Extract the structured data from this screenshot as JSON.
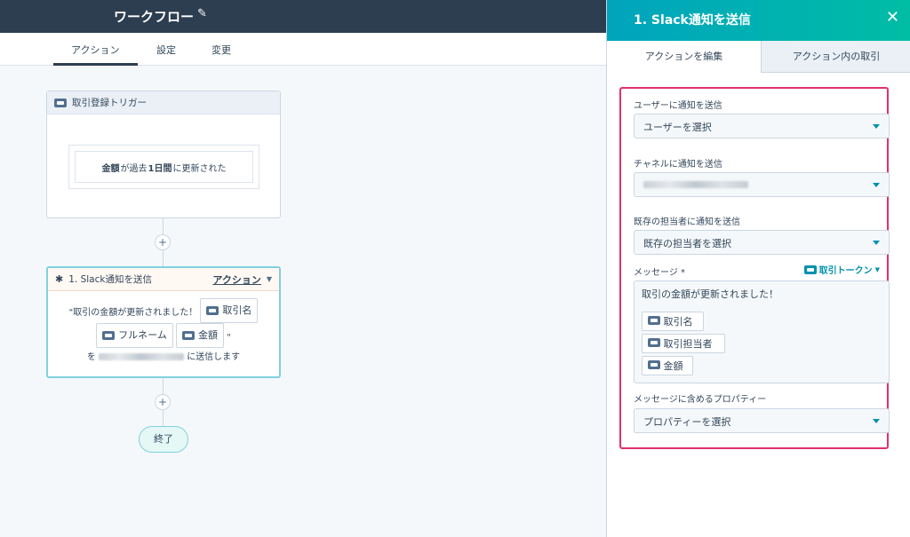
{
  "topbar": {
    "title": "ワークフロー",
    "edit_icon": "pencil-icon"
  },
  "tabs": [
    {
      "label": "アクション"
    },
    {
      "label": "設定"
    },
    {
      "label": "変更"
    }
  ],
  "trigger": {
    "title": "取引登録トリガー",
    "condition_bold1": "金額",
    "condition_mid": "が過去",
    "condition_bold2": "1日間",
    "condition_end": "に更新された"
  },
  "action": {
    "title": "1. Slack通知を送信",
    "type_label": "アクション",
    "message_prefix": "\"取引の金額が更新されました！",
    "tokens": [
      "取引名",
      "フルネーム",
      "金額"
    ],
    "suffix_quote": "\"",
    "send_prefix": "を",
    "send_suffix": "に送信します"
  },
  "end_label": "終了",
  "panel": {
    "title": "1. Slack通知を送信",
    "tabs": [
      "アクションを編集",
      "アクション内の取引"
    ],
    "fields": {
      "user_label": "ユーザーに通知を送信",
      "user_value": "ユーザーを選択",
      "channel_label": "チャネルに通知を送信",
      "owner_label": "既存の担当者に通知を送信",
      "owner_value": "既存の担当者を選択",
      "message_label": "メッセージ *",
      "token_link": "取引トークン",
      "message_text": "取引の金額が更新されました！",
      "message_tokens": [
        "取引名",
        "取引担当者",
        "金額"
      ],
      "props_label": "メッセージに含めるプロパティー",
      "props_value": "プロパティーを選択"
    }
  }
}
